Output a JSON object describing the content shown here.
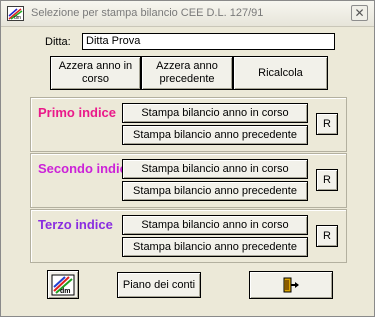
{
  "window": {
    "title": "Selezione per stampa bilancio CEE D.L. 127/91",
    "close_symbol": "✕"
  },
  "ditta": {
    "label": "Ditta:",
    "value": "Ditta Prova"
  },
  "top_buttons": {
    "azzera_corso": "Azzera anno in corso",
    "azzera_precedente": "Azzera anno precedente",
    "ricalcola": "Ricalcola"
  },
  "groups": [
    {
      "title": "Primo indice",
      "color": "#ea1a8a",
      "stampa_corso": "Stampa bilancio anno in corso",
      "stampa_precedente": "Stampa bilancio anno precedente",
      "reset": "R"
    },
    {
      "title": "Secondo indice",
      "color": "#cc22d8",
      "stampa_corso": "Stampa bilancio anno in corso",
      "stampa_precedente": "Stampa bilancio anno precedente",
      "reset": "R"
    },
    {
      "title": "Terzo indice",
      "color": "#8a2ee0",
      "stampa_corso": "Stampa bilancio anno in corso",
      "stampa_precedente": "Stampa bilancio anno precedente",
      "reset": "R"
    }
  ],
  "bottom": {
    "piano_conti": "Piano dei conti",
    "chart_icon": "chart-icon",
    "exit_icon": "exit-door-icon"
  }
}
